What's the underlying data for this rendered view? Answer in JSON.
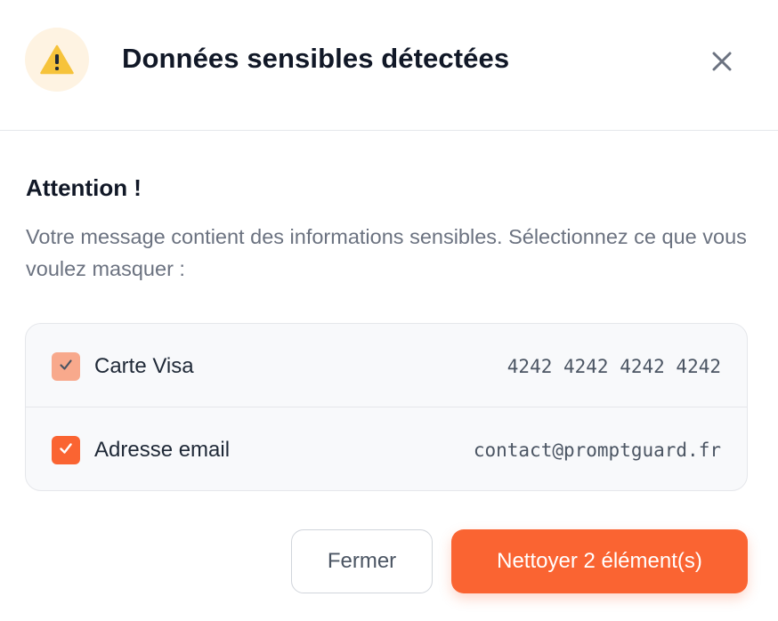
{
  "dialog": {
    "title": "Données sensibles détectées",
    "close_icon": "close-icon",
    "warning_icon": "warning-icon"
  },
  "body": {
    "heading": "Attention !",
    "description": "Votre message contient des informations sensibles. Sélectionnez ce que vous voulez masquer :"
  },
  "items": [
    {
      "label": "Carte Visa",
      "value": "4242 4242 4242 4242",
      "checked": true,
      "style": "muted"
    },
    {
      "label": "Adresse email",
      "value": "contact@promptguard.fr",
      "checked": true,
      "style": "active"
    }
  ],
  "actions": {
    "close_label": "Fermer",
    "clean_label": "Nettoyer 2 élément(s)"
  },
  "colors": {
    "accent": "#fa6432",
    "accent_muted": "#f8a98c",
    "warning_bg": "#fef3e2",
    "warning_icon": "#f6c33b"
  }
}
